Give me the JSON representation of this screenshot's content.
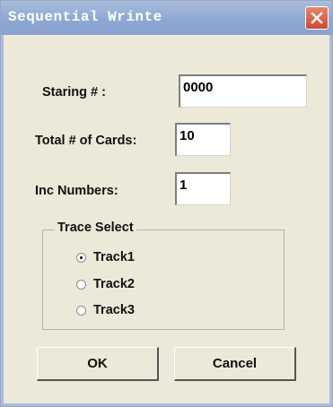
{
  "window": {
    "title": "Sequential Wrinte"
  },
  "form": {
    "starting_label": "Staring # :",
    "starting_value": "0000",
    "total_label": "Total # of Cards:",
    "total_value": "10",
    "inc_label": "Inc Numbers:",
    "inc_value": "1"
  },
  "trace_select": {
    "title": "Trace Select",
    "options": [
      {
        "label": "Track1",
        "checked": true
      },
      {
        "label": "Track2",
        "checked": false
      },
      {
        "label": "Track3",
        "checked": false
      }
    ]
  },
  "buttons": {
    "ok": "OK",
    "cancel": "Cancel"
  },
  "colors": {
    "titlebar": "#8ea8d3",
    "close": "#d9593a",
    "dialog": "#ece9d8"
  }
}
